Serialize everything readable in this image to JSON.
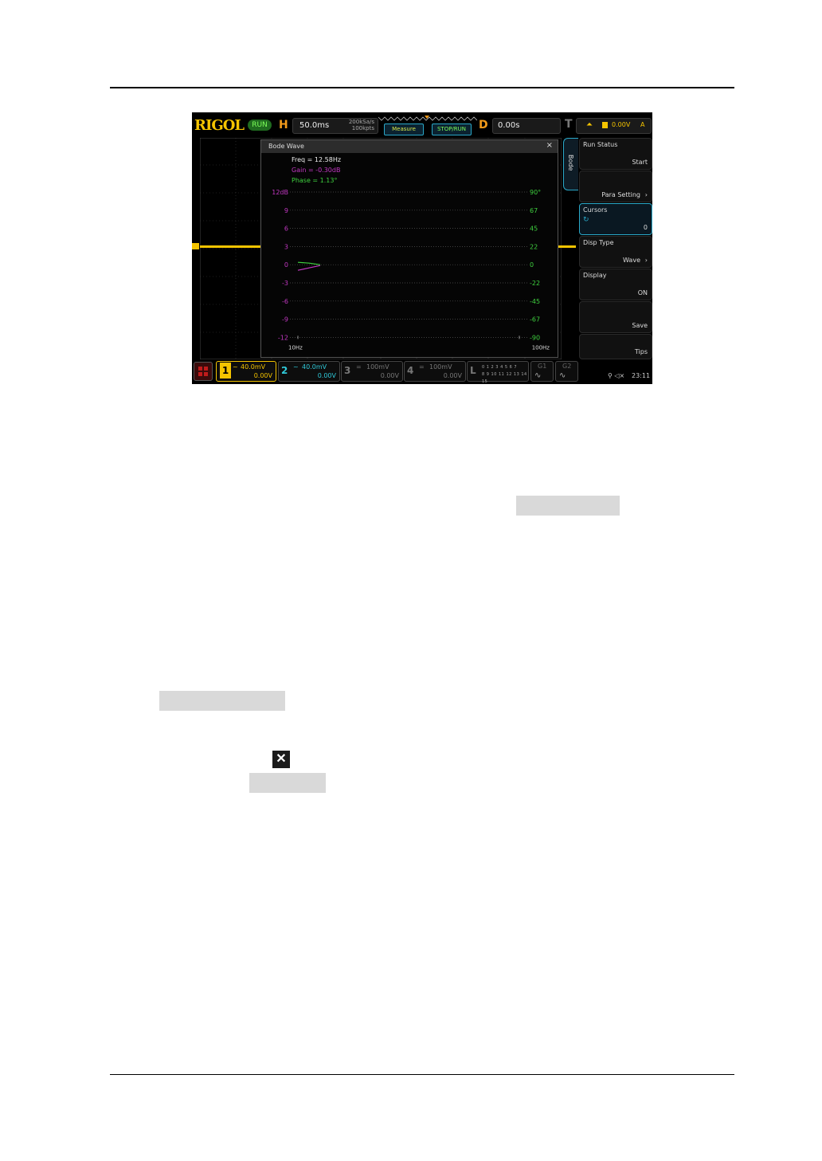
{
  "topbar": {
    "logo": "RIGOL",
    "run_status": "RUN",
    "horizontal_letter": "H",
    "timebase": "50.0ms",
    "sample_rate": "200kSa/s",
    "memory_depth": "100kpts",
    "measure_label": "Measure",
    "stoprun_label": "STOP/RUN",
    "delay_letter": "D",
    "delay_value": "0.00s",
    "trigger_letter": "T",
    "trigger_level": "0.00V",
    "trigger_mode": "A"
  },
  "bode_dialog": {
    "title": "Bode Wave",
    "close_glyph": "×",
    "freq_readout": "Freq = 12.58Hz",
    "gain_readout": "Gain = -0.30dB",
    "phase_readout": "Phase = 1.13°",
    "gain_labels": [
      "12dB",
      "9",
      "6",
      "3",
      "0",
      "-3",
      "-6",
      "-9",
      "-12"
    ],
    "phase_labels": [
      "90°",
      "67",
      "45",
      "22",
      "0",
      "-22",
      "-45",
      "-67",
      "-90"
    ],
    "x_start_label": "10Hz",
    "x_end_label": "100Hz",
    "colors": {
      "gain": "#c238c2",
      "phase": "#3fd13f",
      "readout": "#eeeeee"
    }
  },
  "side_menu": {
    "tab_label": "Bode",
    "items": [
      {
        "label": "Run Status",
        "value": "Start",
        "selected": false
      },
      {
        "label": "",
        "value": "Para Setting",
        "selected": false,
        "chevron": true
      },
      {
        "label": "Cursors",
        "value": "0",
        "selected": true,
        "icon": "rotate-knob-icon"
      },
      {
        "label": "Disp Type",
        "value": "Wave",
        "selected": false,
        "chevron": true
      },
      {
        "label": "Display",
        "value": "ON",
        "selected": false
      },
      {
        "label": "",
        "value": "Save",
        "selected": false
      },
      {
        "label": "",
        "value": "Tips",
        "selected": false
      }
    ]
  },
  "channels": [
    {
      "num": "1",
      "coupling": "~",
      "scale": "40.0mV",
      "offset": "0.00V",
      "color": "#f5c400"
    },
    {
      "num": "2",
      "coupling": "~",
      "scale": "40.0mV",
      "offset": "0.00V",
      "color": "#2fc8d8"
    },
    {
      "num": "3",
      "coupling": "=",
      "scale": "100mV",
      "offset": "0.00V",
      "color": "#777777"
    },
    {
      "num": "4",
      "coupling": "=",
      "scale": "100mV",
      "offset": "0.00V",
      "color": "#777777"
    }
  ],
  "logic": {
    "letter": "L",
    "row1": "0 1 2 3  4 5 6 7",
    "row2": "8 9 10 11 12 13 14 15"
  },
  "generators": [
    {
      "label": "G1",
      "wave": "∿"
    },
    {
      "label": "G2",
      "wave": "∿"
    }
  ],
  "status": {
    "icons": "⚲ ◁×",
    "clock": "23:11"
  },
  "document": {
    "x_glyph": "✕"
  }
}
